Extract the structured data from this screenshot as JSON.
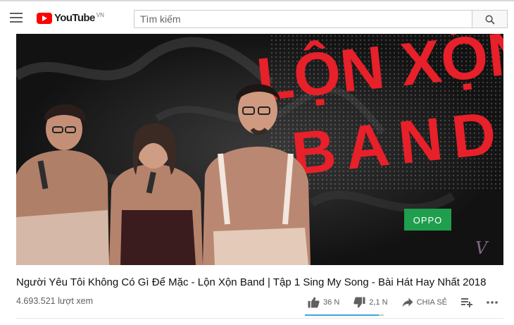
{
  "header": {
    "logo_text": "YouTube",
    "logo_country": "VN",
    "search_placeholder": "Tìm kiếm",
    "menu_icon": "hamburger-menu-icon",
    "search_icon": "magnifier-icon"
  },
  "video": {
    "title": "Người Yêu Tôi Không Có Gì Để Mặc - Lộn Xộn Band | Tập 1 Sing My Song - Bài Hát Hay Nhất 2018",
    "views": "4.693.521 lượt xem",
    "thumbnail": {
      "overlay_line1": "LỘN XỘN",
      "overlay_line2": "BAND",
      "sponsor_logo": "OPPO",
      "channel_watermark": "V",
      "accent_color": "#e8202a",
      "sponsor_color": "#1f9e4d"
    }
  },
  "actions": {
    "like_count": "36 N",
    "dislike_count": "2,1 N",
    "share_label": "CHIA SẺ",
    "like_ratio": 0.94,
    "like_icon": "thumbs-up-icon",
    "dislike_icon": "thumbs-down-icon",
    "share_icon": "share-arrow-icon",
    "add_icon": "add-to-playlist-icon",
    "more_icon": "more-dots-icon"
  }
}
